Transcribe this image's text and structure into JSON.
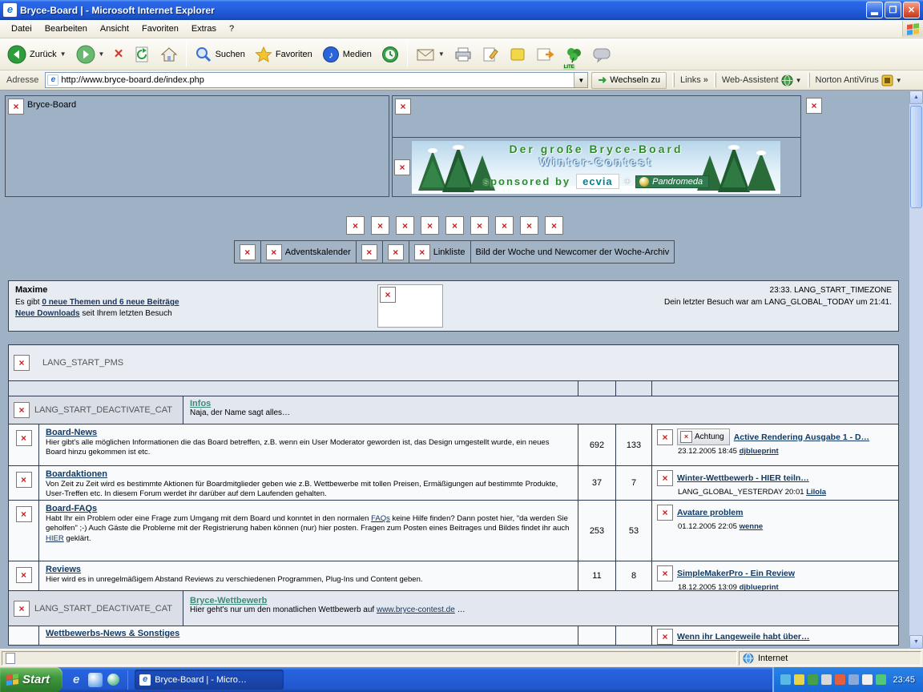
{
  "window": {
    "title": "Bryce-Board | - Microsoft Internet Explorer",
    "status_zone": "Internet",
    "taskbar": {
      "start": "Start",
      "task": "Bryce-Board | - Micro…",
      "clock": "23:45"
    }
  },
  "menubar": {
    "items": [
      "Datei",
      "Bearbeiten",
      "Ansicht",
      "Favoriten",
      "Extras",
      "?"
    ]
  },
  "toolbar": {
    "back": "Zurück",
    "search": "Suchen",
    "favorites": "Favoriten",
    "media": "Medien",
    "lite": "LITE"
  },
  "addressbar": {
    "label": "Adresse",
    "url": "http://www.bryce-board.de/index.php",
    "go": "Wechseln zu",
    "links": "Links",
    "chevron": "»",
    "web_assistant": "Web-Assistent",
    "norton": "Norton AntiVirus"
  },
  "page": {
    "site_name": "Bryce-Board",
    "banner": {
      "line1": "Der große Bryce-Board",
      "line2": "Winter-Contest",
      "sponsored_by": "sponsored by",
      "sponsor1": "ecvia",
      "plus": "+",
      "sponsor2": "Pandromeda"
    },
    "nav": {
      "adventskalender": "Adventskalender",
      "linkliste": "Linkliste",
      "bild_der_woche": "Bild der Woche und Newcomer der Woche-Archiv"
    },
    "infobox": {
      "title": "Maxime",
      "line1": [
        {
          "text": "Es gibt "
        },
        {
          "text": "0 neue Themen und 6 neue Beiträge",
          "link": true,
          "bold": true
        }
      ],
      "line2": [
        {
          "text": "Neue Downloads",
          "link": true,
          "bold": true
        },
        {
          "text": " seit Ihrem letzten Besuch"
        }
      ],
      "time": "23:33. LANG_START_TIMEZONE",
      "last_visit": "Dein letzter Besuch war am LANG_GLOBAL_TODAY um 21:41."
    },
    "pms_label": "LANG_START_PMS",
    "deactivate_cat": "LANG_START_DEACTIVATE_CAT",
    "categories": [
      {
        "title": "Infos",
        "subtitle": [
          {
            "text": "Naja, der Name sagt alles…"
          }
        ]
      },
      {
        "title": "Bryce-Wettbewerb",
        "subtitle": [
          {
            "text": "Hier geht's nur um den monatlichen Wettbewerb auf "
          },
          {
            "text": "www.bryce-contest.de",
            "link": true
          },
          {
            "text": " …"
          }
        ]
      }
    ],
    "forums": [
      {
        "name": "Board-News",
        "desc": [
          {
            "text": "Hier gibt's alle möglichen Informationen die das Board betreffen, z.B. wenn ein User Moderator geworden ist, das Design umgestellt wurde, ein neues Board hinzu gekommen ist etc."
          }
        ],
        "threads": "692",
        "posts": "133",
        "badge": "Achtung",
        "topic": "Active Rendering Ausgabe 1 - D…",
        "date": "23.12.2005 18:45",
        "user": "djblueprint"
      },
      {
        "name": "Boardaktionen",
        "desc": [
          {
            "text": "Von Zeit zu Zeit wird es bestimmte Aktionen für Boardmitglieder geben wie z.B. Wettbewerbe mit tollen Preisen, Ermäßigungen auf bestimmte Produkte, User-Treffen etc. In diesem Forum werdet ihr darüber auf dem Laufenden gehalten."
          }
        ],
        "threads": "37",
        "posts": "7",
        "topic": "Winter-Wettbewerb - HIER teiln…",
        "date": "LANG_GLOBAL_YESTERDAY 20:01",
        "user": "Lilola"
      },
      {
        "name": "Board-FAQs",
        "desc": [
          {
            "text": "Habt Ihr ein Problem oder eine Frage zum Umgang mit dem Board und konntet in den normalen "
          },
          {
            "text": "FAQs",
            "link": true
          },
          {
            "text": " keine Hilfe finden? Dann postet hier, \"da werden Sie geholfen\" ;-) Auch Gäste die Probleme mit der Registrierung haben können (nur) hier posten. Fragen zum Posten eines Beitrages und Bildes findet ihr auch "
          },
          {
            "text": "HIER",
            "link": true
          },
          {
            "text": " geklärt."
          }
        ],
        "threads": "253",
        "posts": "53",
        "topic": "Avatare problem",
        "date": "01.12.2005 22:05",
        "user": "wenne"
      },
      {
        "name": "Reviews",
        "desc": [
          {
            "text": "Hier wird es in unregelmäßigem Abstand Reviews zu verschiedenen Programmen, Plug-Ins und Content geben."
          }
        ],
        "threads": "11",
        "posts": "8",
        "topic": "SimpleMakerPro - Ein Review",
        "date": "18.12.2005 13:09",
        "user": "djblueprint"
      }
    ],
    "partial_forum": {
      "name": "Wettbewerbs-News & Sonstiges",
      "last": "Wenn ihr Langeweile habt über…"
    }
  }
}
